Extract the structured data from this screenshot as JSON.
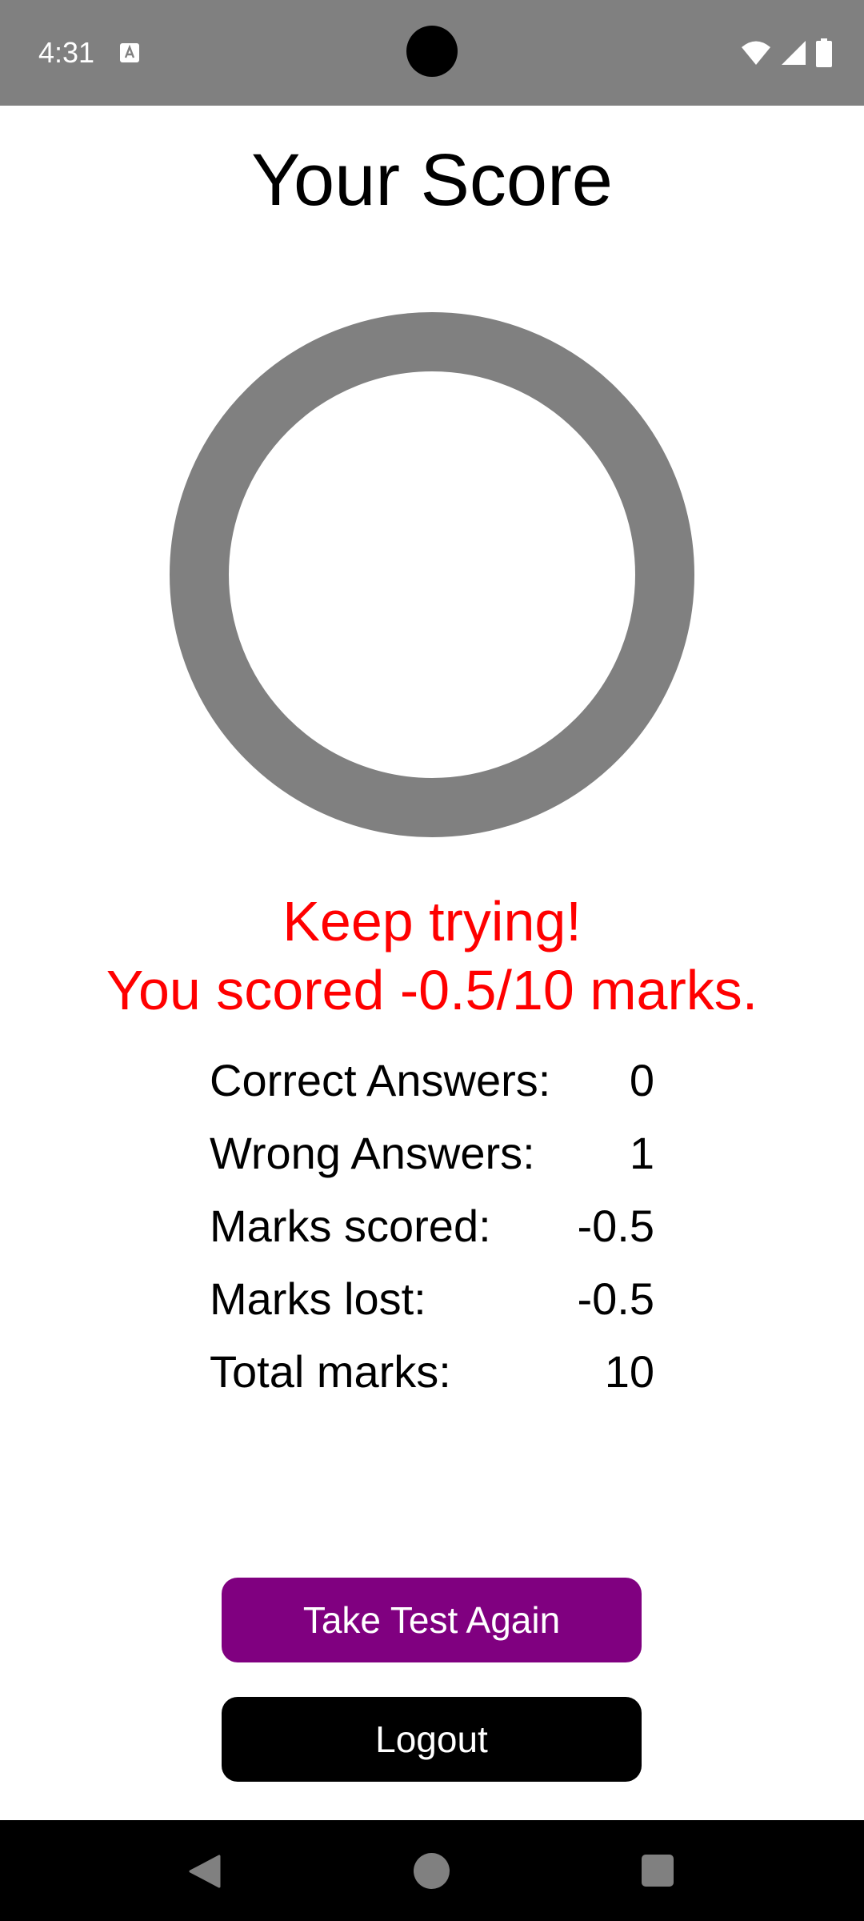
{
  "status_bar": {
    "time": "4:31",
    "notification_icon": "text-format-icon",
    "icons": [
      "wifi-icon",
      "cell-signal-icon",
      "battery-icon"
    ]
  },
  "title": "Your Score",
  "score_ring": {
    "color": "#808080",
    "progress": 0
  },
  "messages": {
    "line1": "Keep trying!",
    "line2": "You scored -0.5/10 marks.",
    "color": "#ff0000"
  },
  "stats": [
    {
      "label": "Correct Answers:",
      "value": "0"
    },
    {
      "label": "Wrong Answers:",
      "value": "1"
    },
    {
      "label": "Marks scored:",
      "value": "-0.5"
    },
    {
      "label": "Marks lost:",
      "value": "-0.5"
    },
    {
      "label": "Total marks:",
      "value": "10"
    }
  ],
  "buttons": {
    "retake": {
      "label": "Take Test Again",
      "color": "#800080"
    },
    "logout": {
      "label": "Logout",
      "color": "#000000"
    }
  },
  "nav_bar": {
    "icons": [
      "back-icon",
      "home-icon",
      "recents-icon"
    ]
  }
}
